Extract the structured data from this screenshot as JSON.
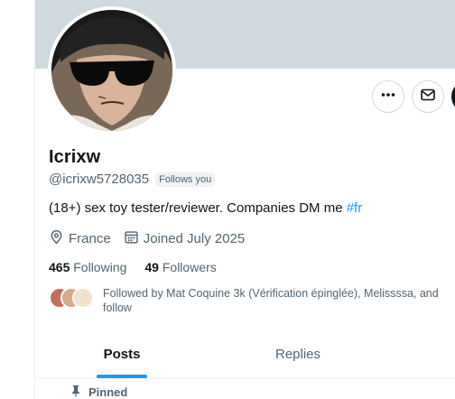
{
  "profile": {
    "display_name": "Icrixw",
    "handle": "@icrixw5728035",
    "follows_you_badge": "Follows you",
    "bio_text": "(18+) sex toy tester/reviewer. Companies DM me ",
    "bio_hashtag": "#fr",
    "location": "France",
    "joined": "Joined July 2025",
    "following_count": "465",
    "following_label": "Following",
    "followers_count": "49",
    "followers_label": "Followers",
    "followed_by_line1": "Followed by Mat Coquine 3k (Vérification épinglée), Melissssa, and",
    "followed_by_line2": "follow"
  },
  "tabs": [
    {
      "label": "Posts",
      "active": true
    },
    {
      "label": "Replies",
      "active": false
    }
  ],
  "pinned_label": "Pinned",
  "icons": {
    "more": "more-icon",
    "message": "mail-icon",
    "location": "location-pin-icon",
    "calendar": "calendar-icon",
    "pin": "pin-icon"
  },
  "colors": {
    "accent": "#1d9bf0",
    "banner": "#cfd9de",
    "text_secondary": "#536471"
  }
}
